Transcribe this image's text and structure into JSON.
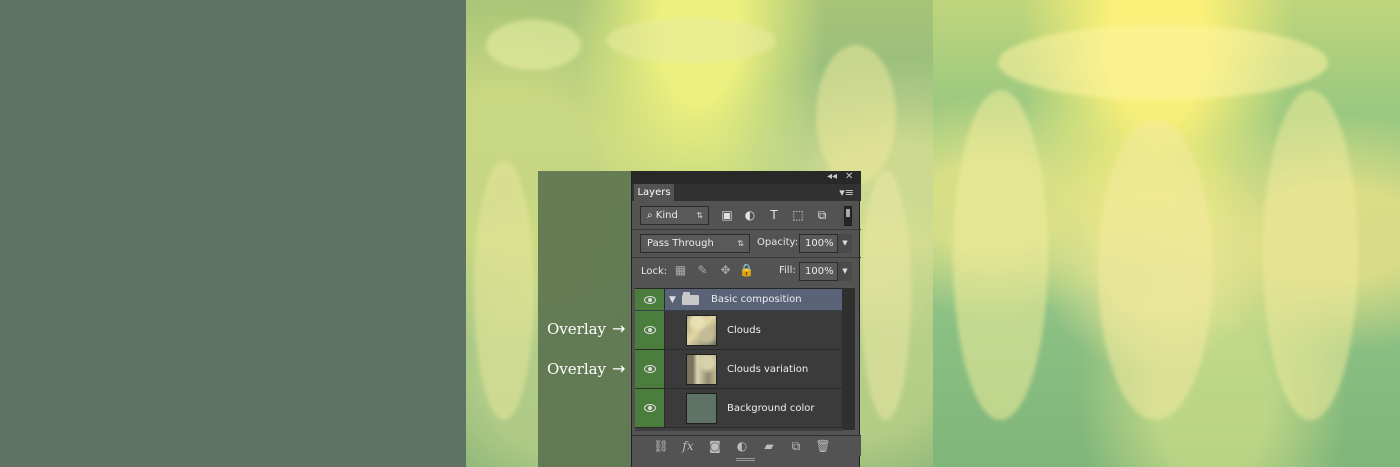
{
  "annotations": {
    "overlay_top": "Overlay",
    "overlay_bottom": "Overlay",
    "arrow": "→"
  },
  "layers_panel": {
    "title_controls": {
      "collapse": "◂◂",
      "close": "✕"
    },
    "tab": "Layers",
    "panel_menu": "▾≡",
    "filter": {
      "kind_label": "Kind",
      "search_symbol": "⌕",
      "arrows": "⇅"
    },
    "blend": {
      "mode": "Pass Through",
      "arrows": "⇅",
      "opacity_label": "Opacity:",
      "opacity_value": "100%",
      "dropdown_arrow": "▼"
    },
    "lock": {
      "label": "Lock:",
      "fill_label": "Fill:",
      "fill_value": "100%",
      "dropdown_arrow": "▼"
    },
    "layers": [
      {
        "name": "Basic composition",
        "type": "group",
        "visible": true
      },
      {
        "name": "Clouds",
        "type": "layer",
        "visible": true
      },
      {
        "name": "Clouds variation",
        "type": "layer",
        "visible": true
      },
      {
        "name": "Background color",
        "type": "layer",
        "visible": true
      }
    ],
    "bottom_icons": [
      "link-icon",
      "fx-icon",
      "mask-icon",
      "adjustment-icon",
      "folder-icon",
      "new-layer-icon",
      "trash-icon"
    ]
  },
  "colors": {
    "background_swatch": "#5e7366",
    "selected_group": "#5a6277",
    "visibility_green": "#4b7d3d"
  }
}
